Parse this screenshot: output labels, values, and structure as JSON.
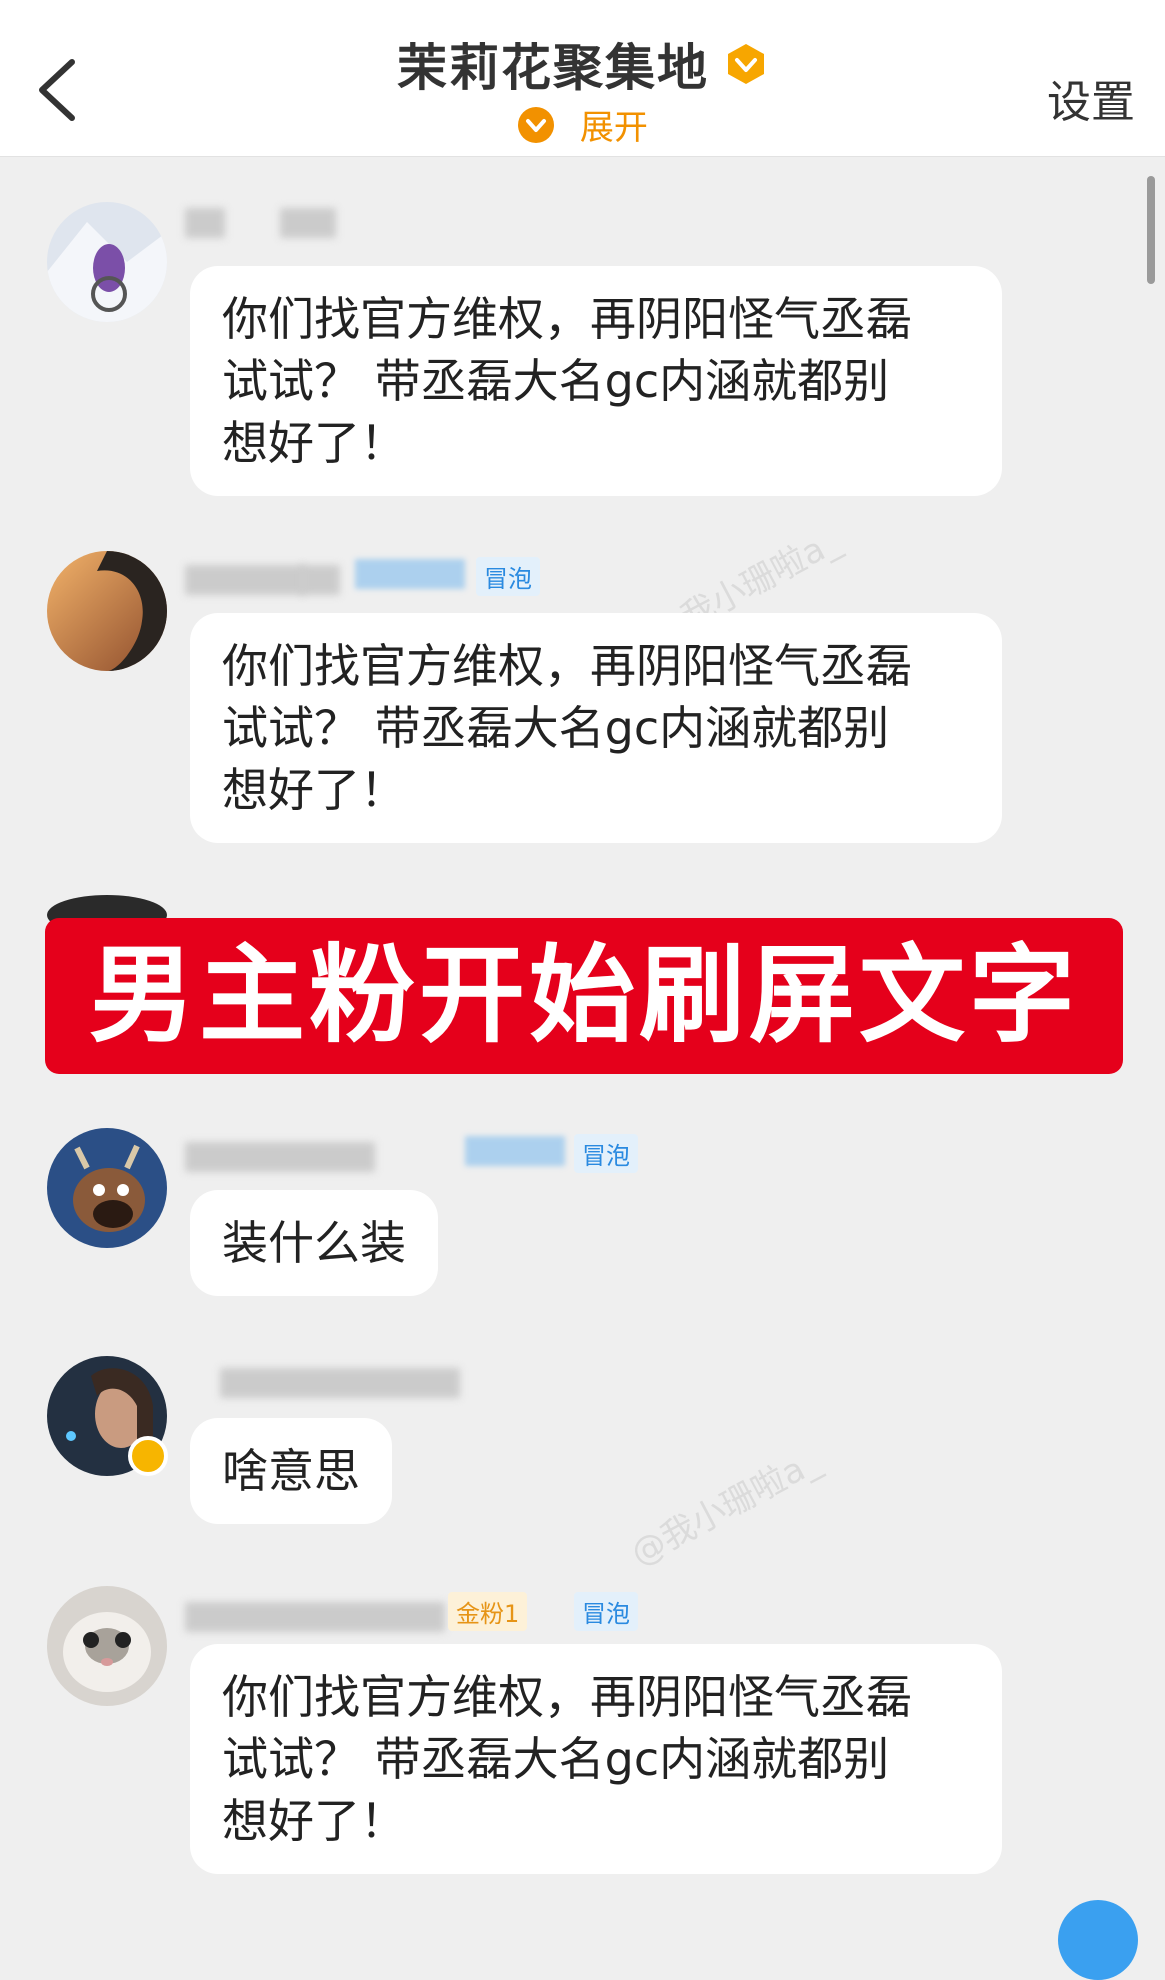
{
  "header": {
    "title": "茉莉花聚集地",
    "expand_label": "展开",
    "settings_label": "设置"
  },
  "banner": {
    "text": "男主粉开始刷屏文字"
  },
  "messages": [
    {
      "lines": [
        "你们找官方维权，再阴阳怪气丞磊",
        "试试？ 带丞磊大名gc内涵就都别",
        "想好了！"
      ]
    },
    {
      "badge": "冒泡",
      "lines": [
        "你们找官方维权，再阴阳怪气丞磊",
        "试试？ 带丞磊大名gc内涵就都别",
        "想好了！"
      ]
    },
    {
      "badge": "冒泡",
      "lines": [
        "装什么装"
      ]
    },
    {
      "lines": [
        "啥意思"
      ]
    },
    {
      "badge_gold": "金粉1",
      "badge": "冒泡",
      "lines": [
        "你们找官方维权，再阴阳怪气丞磊",
        "试试？ 带丞磊大名gc内涵就都别",
        "想好了！"
      ]
    }
  ],
  "watermarks": [
    "@我小珊啦a_",
    "@我小珊啦a_"
  ],
  "colors": {
    "accent_orange": "#f29100",
    "banner_red": "#e5001b",
    "badge_blue": "#2a8ae0"
  }
}
